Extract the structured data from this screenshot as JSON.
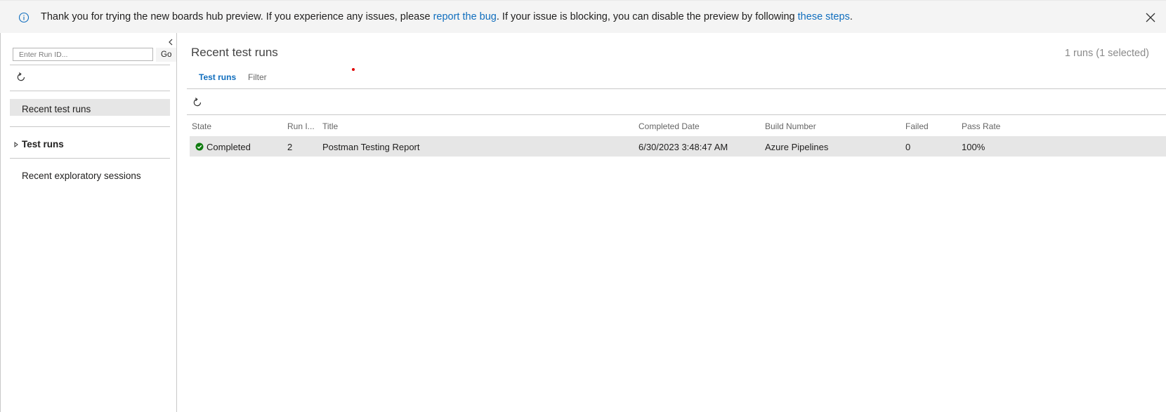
{
  "banner": {
    "message_prefix": "Thank you for trying the new boards hub preview. If you experience any issues, please ",
    "report_link": "report the bug",
    "message_middle": ". If your issue is blocking, you can disable the preview by following ",
    "steps_link": "these steps",
    "message_suffix": ".",
    "icons": {
      "info": "info-icon",
      "close": "close-icon"
    }
  },
  "sidebar": {
    "run_id_placeholder": "Enter Run ID...",
    "go_label": "Go",
    "items": [
      {
        "label": "Recent test runs",
        "selected": true
      },
      {
        "label": "Test runs",
        "expandable": true
      },
      {
        "label": "Recent exploratory sessions"
      }
    ]
  },
  "main": {
    "title": "Recent test runs",
    "count_text": "1 runs (1 selected)",
    "tabs": [
      {
        "label": "Test runs",
        "active": true
      },
      {
        "label": "Filter",
        "active": false
      }
    ],
    "columns": [
      "State",
      "Run I...",
      "Title",
      "Completed Date",
      "Build Number",
      "Failed",
      "Pass Rate"
    ],
    "rows": [
      {
        "state": "Completed",
        "run_id": "2",
        "title": "Postman Testing Report",
        "completed_date": "6/30/2023 3:48:47 AM",
        "build_number": "Azure Pipelines",
        "failed": "0",
        "pass_rate": "100%"
      }
    ]
  },
  "colors": {
    "accent": "#106ebe",
    "success": "#107c10",
    "selected_row": "#e6e6e6",
    "banner_bg": "#f4f4f4"
  }
}
